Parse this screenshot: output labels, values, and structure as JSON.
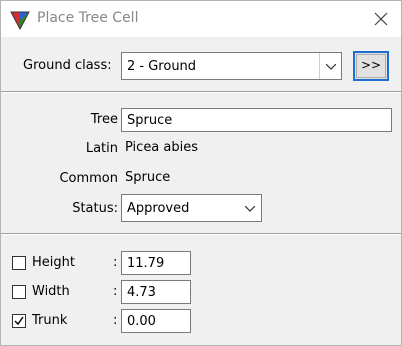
{
  "window": {
    "title": "Place Tree Cell",
    "icons": {
      "app": "tree-cell-app-icon",
      "close": "close-icon"
    }
  },
  "ground": {
    "label": "Ground class:",
    "selected": "2 - Ground",
    "more_button": ">>"
  },
  "tree": {
    "tree_label": "Tree",
    "tree_value": "Spruce",
    "latin_label": "Latin",
    "latin_value": "Picea abies",
    "common_label": "Common",
    "common_value": "Spruce",
    "status_label": "Status:",
    "status_value": "Approved"
  },
  "dimensions": {
    "colon": ":",
    "rows": [
      {
        "label": "Height",
        "value": "11.79",
        "checked": false
      },
      {
        "label": "Width",
        "value": "4.73",
        "checked": false
      },
      {
        "label": "Trunk",
        "value": "0.00",
        "checked": true
      }
    ]
  },
  "colors": {
    "dialog_bg": "#f0f0f0",
    "focus_border": "#1f6fd1",
    "title_text": "#888888"
  }
}
